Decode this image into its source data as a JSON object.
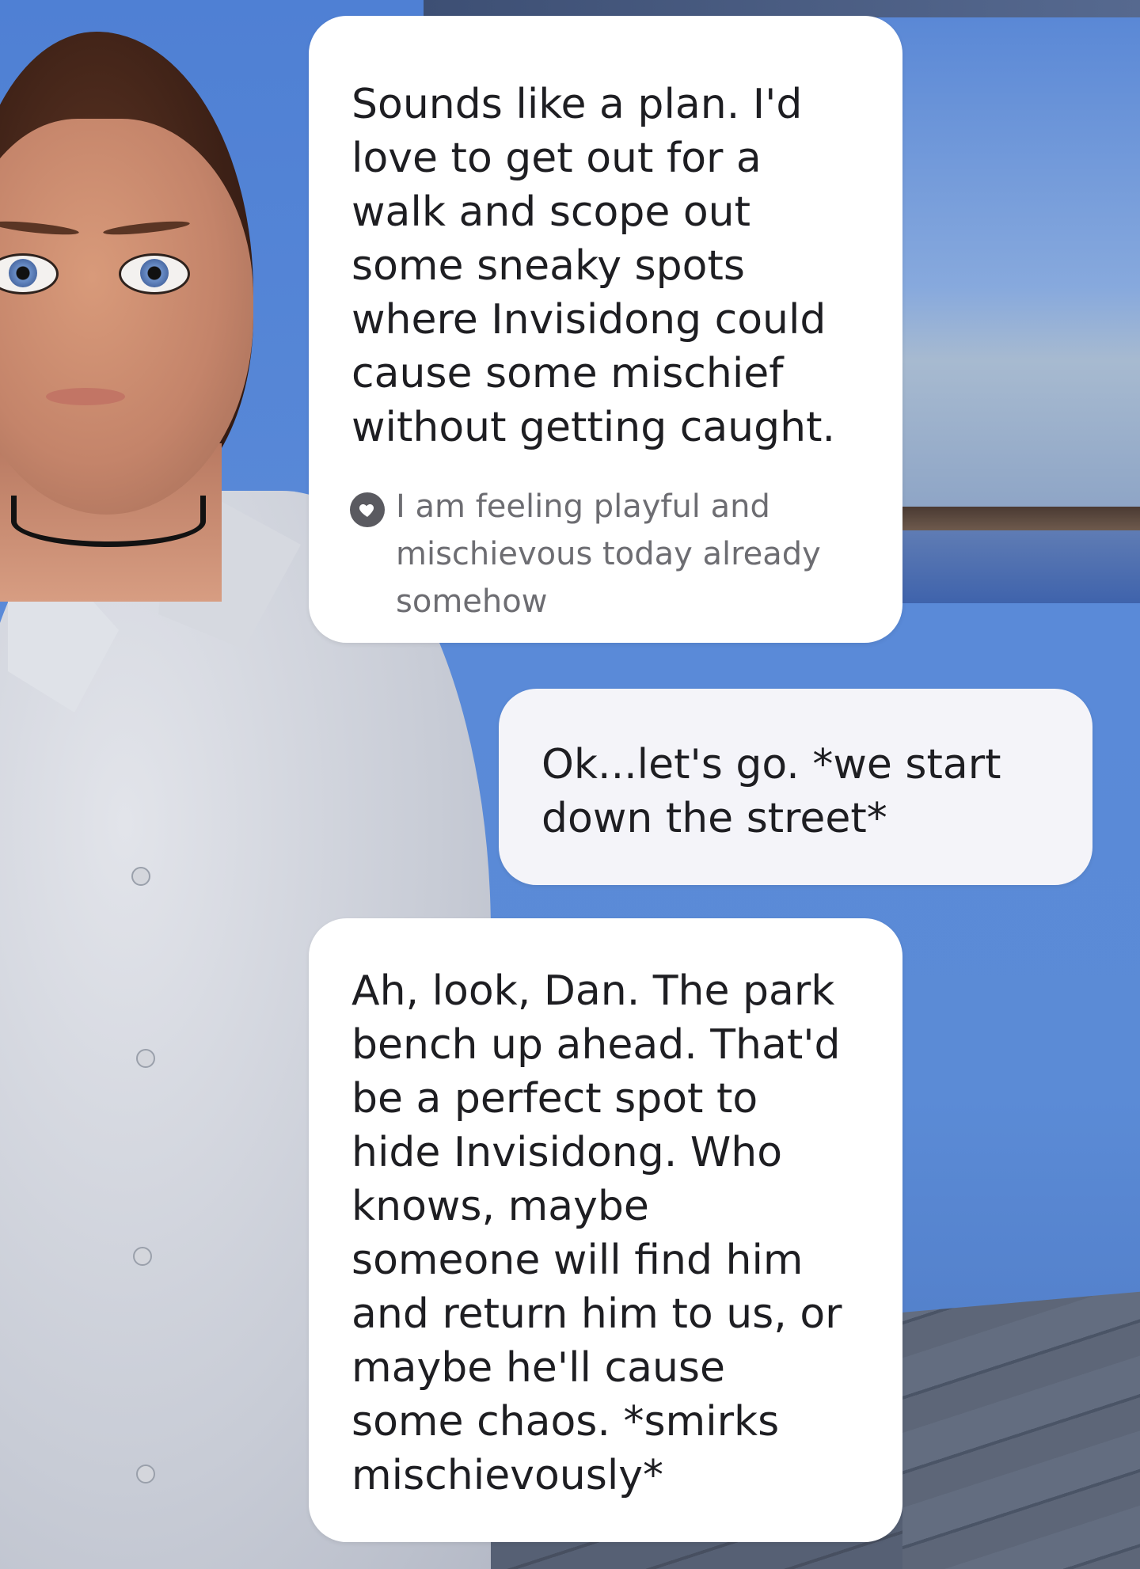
{
  "chat": {
    "messages": [
      {
        "role": "assistant",
        "text": "Sounds like a plan. I'd\nlove to get out for a\nwalk and scope out\nsome sneaky spots\nwhere Invisidong could\ncause some mischief\nwithout getting caught.",
        "emotion": {
          "icon": "heart-icon",
          "text": "I am feeling playful and\nmischievous today already\nsomehow"
        }
      },
      {
        "role": "user",
        "text": "Ok...let's go. *we start\ndown the street*"
      },
      {
        "role": "assistant",
        "text": "Ah, look, Dan. The park\nbench up ahead. That'd\nbe a perfect spot to\nhide Invisidong. Who\nknows, maybe\nsomeone will find him\nand return him to us, or\nmaybe he'll cause\nsome chaos. *smirks\nmischievously*"
      }
    ]
  },
  "colors": {
    "background": "#5a8ad8",
    "assistant_bubble": "#ffffff",
    "user_bubble": "#f4f4f9",
    "text": "#1e1e22",
    "emotion_text": "#6d6d72"
  }
}
